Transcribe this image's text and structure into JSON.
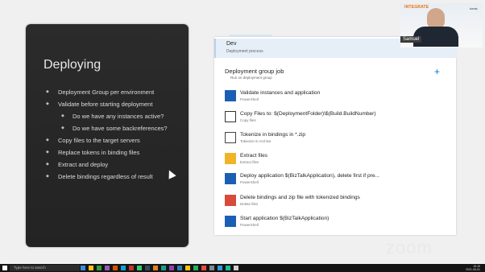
{
  "slide": {
    "title": "Deploying",
    "bullets": [
      {
        "text": "Deployment Group per environment",
        "level": 1
      },
      {
        "text": "Validate before starting deployment",
        "level": 1
      },
      {
        "text": "Do we have any instances active?",
        "level": 2
      },
      {
        "text": "Do we have some backreferences?",
        "level": 2
      },
      {
        "text": "Copy files to the target servers",
        "level": 1
      },
      {
        "text": "Replace tokens in binding files",
        "level": 1
      },
      {
        "text": "Extract and deploy",
        "level": 1
      },
      {
        "text": "Delete bindings regardless of result",
        "level": 1
      }
    ]
  },
  "pipeline": {
    "env": {
      "title": "Dev",
      "subtitle": "Deployment process"
    },
    "job": {
      "title": "Deployment group job",
      "subtitle": "Run on deployment group"
    },
    "tasks": [
      {
        "title": "Validate instances and application",
        "subtitle": "PowerShell",
        "icon": "powershell-icon"
      },
      {
        "title": "Copy Files to: $(DeploymentFolder)\\$(Build.BuildNumber)",
        "subtitle": "Copy files",
        "icon": "copy-files-icon"
      },
      {
        "title": "Tokenize in bindings in *.zip",
        "subtitle": "Tokenize in Archive",
        "icon": "tokenize-icon"
      },
      {
        "title": "Extract files",
        "subtitle": "Extract files",
        "icon": "archive-icon"
      },
      {
        "title": "Deploy application $(BizTalkApplication), delete first if pre...",
        "subtitle": "PowerShell",
        "icon": "powershell-icon"
      },
      {
        "title": "Delete bindings and zip file with tokenized bindings",
        "subtitle": "Delete files",
        "icon": "trash-icon"
      },
      {
        "title": "Start application $(BizTalkApplication)",
        "subtitle": "PowerShell",
        "icon": "powershell-icon"
      }
    ]
  },
  "webcam": {
    "name": "Samuel",
    "logo_text": "INTEGRATE",
    "logo_right": "kovai."
  },
  "zoom_logo": "zoom",
  "taskbar": {
    "search_placeholder": "Type here to search",
    "time": "15:15",
    "date": "2021-06-01"
  }
}
